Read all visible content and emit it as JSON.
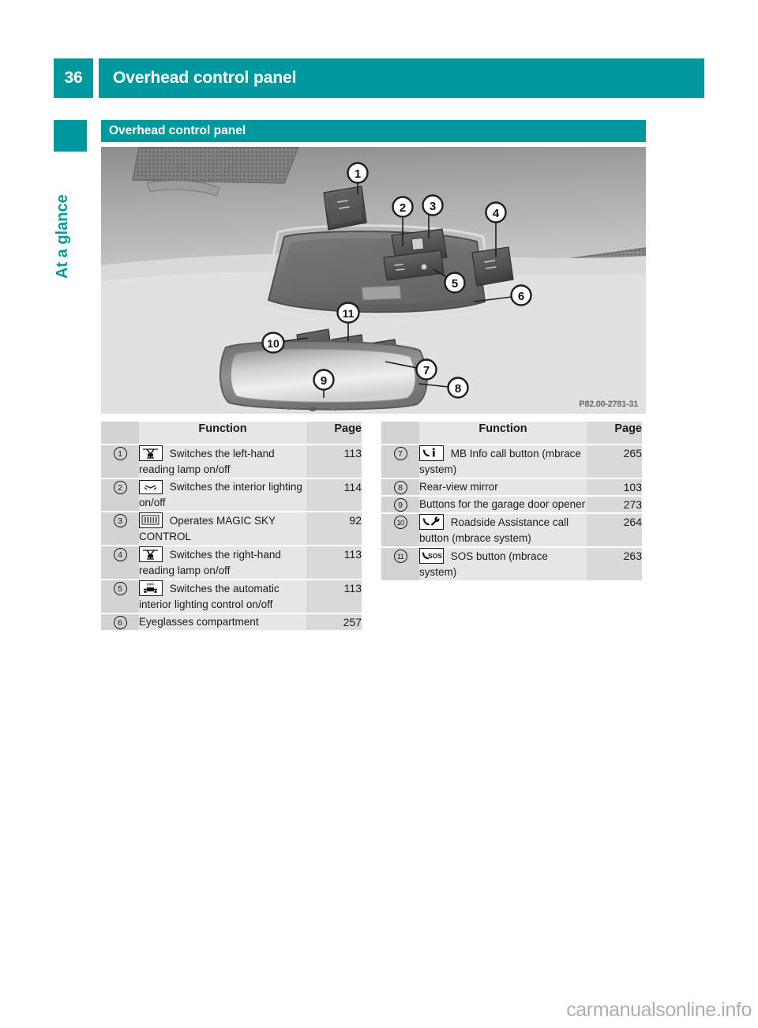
{
  "header": {
    "page_number": "36",
    "title": "Overhead control panel"
  },
  "sidebar": {
    "chapter_label": "At a glance"
  },
  "section": {
    "heading": "Overhead control panel"
  },
  "illustration": {
    "name": "overhead-control-panel-diagram",
    "reference_code": "P82.00-2781-31",
    "callouts": [
      "1",
      "2",
      "3",
      "4",
      "5",
      "6",
      "7",
      "8",
      "9",
      "10",
      "11"
    ]
  },
  "tables": {
    "left": {
      "headers": {
        "function": "Function",
        "page": "Page"
      },
      "rows": [
        {
          "num": "1",
          "icon": "reading-lamp-icon",
          "text": "Switches the left-hand reading lamp on/off",
          "page": "113"
        },
        {
          "num": "2",
          "icon": "interior-lighting-icon",
          "text": "Switches the interior lighting on/off",
          "page": "114"
        },
        {
          "num": "3",
          "icon": "magic-sky-control-icon",
          "text": "Operates MAGIC SKY CONTROL",
          "page": "92"
        },
        {
          "num": "4",
          "icon": "reading-lamp-icon",
          "text": "Switches the right-hand reading lamp on/off",
          "page": "113"
        },
        {
          "num": "5",
          "icon": "automatic-interior-lighting-off-icon",
          "text": "Switches the automatic interior lighting control on/off",
          "page": "113"
        },
        {
          "num": "6",
          "icon": "",
          "text": "Eyeglasses compartment",
          "page": "257"
        }
      ]
    },
    "right": {
      "headers": {
        "function": "Function",
        "page": "Page"
      },
      "rows": [
        {
          "num": "7",
          "icon": "phone-info-icon",
          "text": "MB Info call button (mbrace system)",
          "page": "265"
        },
        {
          "num": "8",
          "icon": "",
          "text": "Rear-view mirror",
          "page": "103"
        },
        {
          "num": "9",
          "icon": "",
          "text": "Buttons for the garage door opener",
          "page": "273"
        },
        {
          "num": "10",
          "icon": "phone-wrench-icon",
          "text": "Roadside Assistance call button (mbrace system)",
          "page": "264"
        },
        {
          "num": "11",
          "icon": "phone-sos-icon",
          "text": "SOS button (mbrace system)",
          "page": "263"
        }
      ]
    }
  },
  "watermark": {
    "text": "carmanualsonline.info"
  },
  "colors": {
    "accent_teal": "#009a9e",
    "table_num_col": "#d2d2d2",
    "table_fn_col": "#e6e6e6",
    "table_page_col": "#d9d9d9",
    "watermark_gray": "#aeaeae"
  }
}
